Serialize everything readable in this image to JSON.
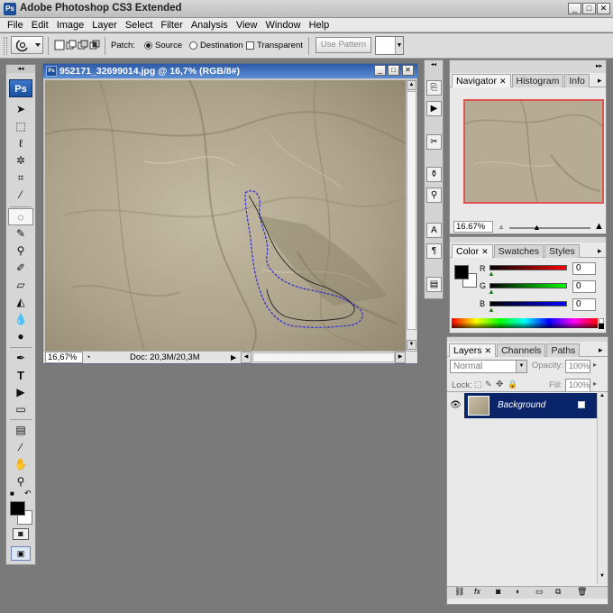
{
  "app": {
    "title": "Adobe Photoshop CS3 Extended",
    "badge": "Ps"
  },
  "menu": [
    "File",
    "Edit",
    "Image",
    "Layer",
    "Select",
    "Filter",
    "Analysis",
    "View",
    "Window",
    "Help"
  ],
  "options": {
    "patch_label": "Patch:",
    "source_label": "Source",
    "destination_label": "Destination",
    "transparent_label": "Transparent",
    "use_pattern_label": "Use Pattern"
  },
  "toolbox": {
    "logo": "Ps"
  },
  "document": {
    "title": "952171_32699014.jpg @ 16,7% (RGB/8#)",
    "zoom": "16,67%",
    "doc_info": "Doc: 20,3M/20,3M"
  },
  "navigator": {
    "tabs": [
      "Navigator",
      "Histogram",
      "Info"
    ],
    "zoom": "16.67%"
  },
  "color": {
    "tabs": [
      "Color",
      "Swatches",
      "Styles"
    ],
    "r_label": "R",
    "g_label": "G",
    "b_label": "B",
    "r_value": "0",
    "g_value": "0",
    "b_value": "0"
  },
  "layers": {
    "tabs": [
      "Layers",
      "Channels",
      "Paths"
    ],
    "blend_mode": "Normal",
    "opacity_label": "Opacity:",
    "opacity_value": "100%",
    "lock_label": "Lock:",
    "fill_label": "Fill:",
    "fill_value": "100%",
    "layer_name": "Background"
  },
  "colors": {
    "title_blue": "#2d5aa8",
    "selection_blue": "#0a246a",
    "workspace_gray": "#7a7a7a",
    "navigator_frame": "#e15454"
  }
}
